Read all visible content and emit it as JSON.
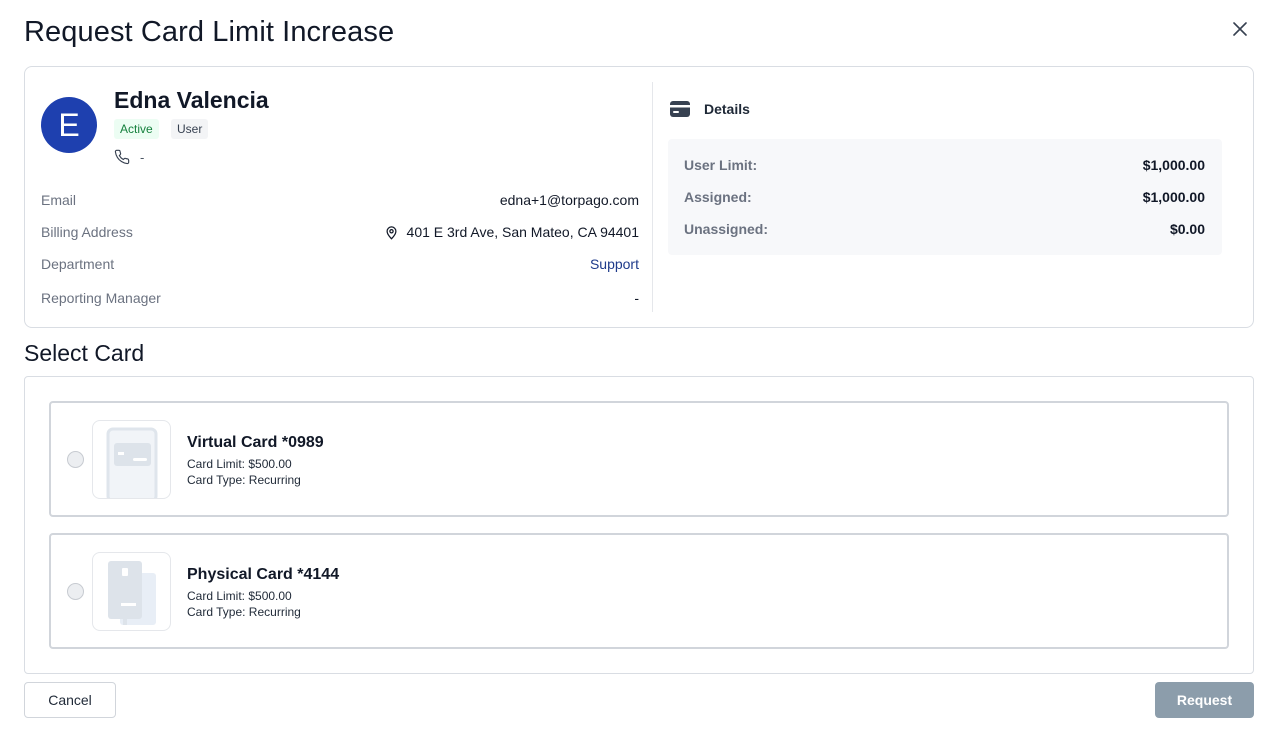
{
  "dialog": {
    "title": "Request Card Limit Increase",
    "close_icon": "close-icon"
  },
  "user": {
    "initial": "E",
    "avatar_color": "#1e40af",
    "name": "Edna Valencia",
    "status_badge": "Active",
    "role_badge": "User",
    "phone": "-",
    "fields": {
      "email_label": "Email",
      "email_value": "edna+1@torpago.com",
      "billing_label": "Billing Address",
      "billing_value": "401 E 3rd Ave, San Mateo, CA 94401",
      "department_label": "Department",
      "department_value": "Support",
      "manager_label": "Reporting Manager",
      "manager_value": "-"
    }
  },
  "details": {
    "heading": "Details",
    "icon": "card-icon",
    "user_limit_label": "User Limit:",
    "user_limit_value": "$1,000.00",
    "assigned_label": "Assigned:",
    "assigned_value": "$1,000.00",
    "unassigned_label": "Unassigned:",
    "unassigned_value": "$0.00"
  },
  "select_card": {
    "heading": "Select Card",
    "cards": [
      {
        "title": "Virtual Card *0989",
        "limit": "Card Limit: $500.00",
        "type": "Card Type: Recurring"
      },
      {
        "title": "Physical Card *4144",
        "limit": "Card Limit: $500.00",
        "type": "Card Type: Recurring"
      }
    ]
  },
  "actions": {
    "cancel_label": "Cancel",
    "request_label": "Request"
  },
  "colors": {
    "active_badge_bg": "#ecfdf3",
    "active_badge_text": "#15803d",
    "request_button_bg": "#8c9dab",
    "link_text": "#1e3a8a"
  }
}
